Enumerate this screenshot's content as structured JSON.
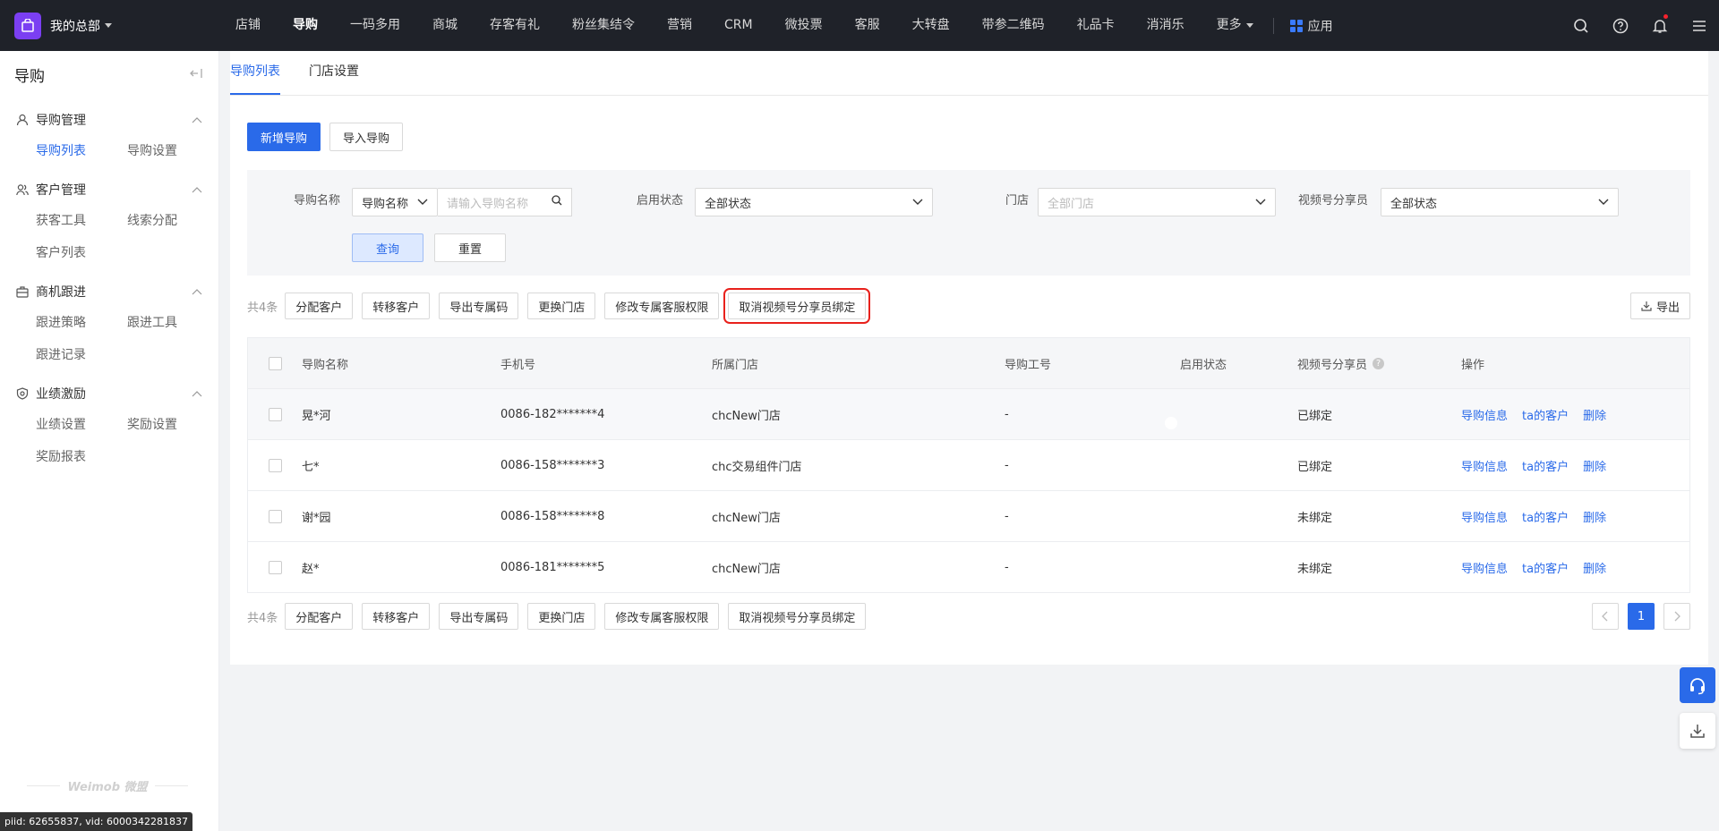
{
  "topbar": {
    "brand": "我的总部",
    "nav": [
      "店铺",
      "导购",
      "一码多用",
      "商城",
      "存客有礼",
      "粉丝集结令",
      "营销",
      "CRM",
      "微投票",
      "客服",
      "大转盘",
      "带参二维码",
      "礼品卡",
      "消消乐",
      "更多"
    ],
    "active_nav": "导购",
    "apps_label": "应用"
  },
  "sidebar": {
    "title": "导购",
    "groups": [
      {
        "label": "导购管理",
        "icon": "user-icon",
        "items": [
          "导购列表",
          "导购设置"
        ]
      },
      {
        "label": "客户管理",
        "icon": "users-icon",
        "items": [
          "获客工具",
          "线索分配",
          "客户列表"
        ]
      },
      {
        "label": "商机跟进",
        "icon": "briefcase-icon",
        "items": [
          "跟进策略",
          "跟进工具",
          "跟进记录"
        ]
      },
      {
        "label": "业绩激励",
        "icon": "badge-icon",
        "items": [
          "业绩设置",
          "奖励设置",
          "奖励报表"
        ]
      }
    ],
    "active_item": "导购列表",
    "footer": "Weimob 微盟",
    "debug": "piid: 62655837, vid: 6000342281837"
  },
  "tabs": [
    "导购列表",
    "门店设置"
  ],
  "actions": {
    "add": "新增导购",
    "import": "导入导购"
  },
  "filters": {
    "name_label": "导购名称",
    "name_type": "导购名称",
    "name_placeholder": "请输入导购名称",
    "status_label": "启用状态",
    "status_value": "全部状态",
    "store_label": "门店",
    "store_placeholder": "全部门店",
    "sharer_label": "视频号分享员",
    "sharer_value": "全部状态",
    "query": "查询",
    "reset": "重置"
  },
  "bulk": {
    "count": "共4条",
    "buttons": [
      "分配客户",
      "转移客户",
      "导出专属码",
      "更换门店",
      "修改专属客服权限",
      "取消视频号分享员绑定"
    ],
    "export": "导出"
  },
  "table": {
    "headers": [
      "导购名称",
      "手机号",
      "所属门店",
      "导购工号",
      "启用状态",
      "视频号分享员",
      "操作"
    ],
    "rows": [
      {
        "name": "晃*河",
        "phone": "0086-182*******4",
        "store": "chcNew门店",
        "no": "-",
        "sharer": "已绑定"
      },
      {
        "name": "七*",
        "phone": "0086-158*******3",
        "store": "chc交易组件门店",
        "no": "-",
        "sharer": "已绑定"
      },
      {
        "name": "谢*园",
        "phone": "0086-158*******8",
        "store": "chcNew门店",
        "no": "-",
        "sharer": "未绑定"
      },
      {
        "name": "赵*",
        "phone": "0086-181*******5",
        "store": "chcNew门店",
        "no": "-",
        "sharer": "未绑定"
      }
    ],
    "row_actions": [
      "导购信息",
      "ta的客户",
      "删除"
    ]
  },
  "pagination": {
    "current": "1"
  },
  "colors": {
    "primary": "#2a6ae9",
    "switch_on": "#23b14d",
    "highlight": "#e8211c",
    "topbar": "#1f2229"
  }
}
